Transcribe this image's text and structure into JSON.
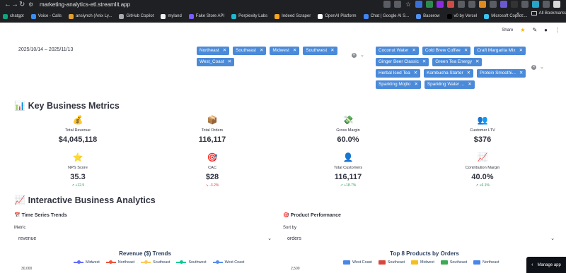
{
  "browser": {
    "url": "marketing-analytics-etl.streamlit.app",
    "bookmarks": [
      {
        "label": "chatgpt",
        "color": "#10a37f"
      },
      {
        "label": "Voice - Calls",
        "color": "#3c8df0"
      },
      {
        "label": "ansiynch (Anix Ly...",
        "color": "#e0a030"
      },
      {
        "label": "GitHub Copilot",
        "color": "#aaaaaa"
      },
      {
        "label": "myland",
        "color": "#f0f0f0"
      },
      {
        "label": "Fake Store API",
        "color": "#7a5cff"
      },
      {
        "label": "Perplexity Labs",
        "color": "#20b8cd"
      },
      {
        "label": "Indeed Scraper",
        "color": "#f5a623"
      },
      {
        "label": "OpenAI Platform",
        "color": "#ffffff"
      },
      {
        "label": "Chat | Google AI S...",
        "color": "#4285f4"
      },
      {
        "label": "Baserow",
        "color": "#5190ef"
      },
      {
        "label": "v0 by Vercel",
        "color": "#000000"
      },
      {
        "label": "Microsoft Copilot:...",
        "color": "#36c5f0"
      }
    ],
    "all_bookmarks": "All Bookmarks",
    "more": "»"
  },
  "header": {
    "share_label": "Share"
  },
  "filters": {
    "date_range": "2025/10/14 – 2025/11/13",
    "regions": [
      "Northeast",
      "Southeast",
      "Midwest",
      "Southwest",
      "West_Coast"
    ],
    "products": [
      "Coconut Water",
      "Cold Brew Coffee",
      "Craft Margarita Mix",
      "Ginger Beer Classic",
      "Green Tea Energy",
      "Herbal Iced Tea",
      "Kombucha Starter",
      "Protein Smoothi...",
      "Sparkling Mojito",
      "Sparkling Water ..."
    ],
    "chip_color": "#4a8ad9"
  },
  "key_metrics": {
    "heading_icon": "📊",
    "heading": "Key Business Metrics",
    "items": [
      {
        "icon": "💰",
        "label": "Total Revenue",
        "value": "$4,045,118",
        "delta": ""
      },
      {
        "icon": "📦",
        "label": "Total Orders",
        "value": "116,117",
        "delta": ""
      },
      {
        "icon": "💸",
        "label": "Gross Margin",
        "value": "60.0%",
        "delta": ""
      },
      {
        "icon": "👥",
        "label": "Customer LTV",
        "value": "$376",
        "delta": ""
      },
      {
        "icon": "⭐",
        "label": "NPS Score",
        "value": "35.3",
        "delta": "↗ +12.5"
      },
      {
        "icon": "🎯",
        "label": "CAC",
        "value": "$28",
        "delta": "↘ -3.2%"
      },
      {
        "icon": "👤",
        "label": "Total Customers",
        "value": "116,117",
        "delta": "↗ +18.7%"
      },
      {
        "icon": "📈",
        "label": "Contribution Margin",
        "value": "40.0%",
        "delta": "↗ +6.1%"
      }
    ]
  },
  "analytics": {
    "heading_icon": "📈",
    "heading": "Interactive Business Analytics",
    "time_series": {
      "title_icon": "📅",
      "title": "Time Series Trends",
      "metric_label": "Metric",
      "metric_value": "revenue",
      "chart_title": "Revenue ($) Trends",
      "y_top_tick": "30,000",
      "legend": [
        {
          "name": "Midwest",
          "color": "#636efa"
        },
        {
          "name": "Northeast",
          "color": "#ef553b"
        },
        {
          "name": "Southeast",
          "color": "#fecb52"
        },
        {
          "name": "Southwest",
          "color": "#00cc96"
        },
        {
          "name": "West Coast",
          "color": "#5a8ef0"
        }
      ]
    },
    "product_performance": {
      "title_icon": "🎯",
      "title": "Product Performance",
      "sort_label": "Sort by",
      "sort_value": "orders",
      "chart_title": "Top 8 Products by Orders",
      "y_top_tick": "2,500",
      "legend": [
        {
          "name": "West Coast",
          "color": "#4a86e8"
        },
        {
          "name": "Southeast",
          "color": "#d9453c"
        },
        {
          "name": "Midwest",
          "color": "#f4c020"
        },
        {
          "name": "Southeast",
          "color": "#3da954"
        },
        {
          "name": "Northeast",
          "color": "#4a86e8"
        }
      ]
    }
  },
  "manage_app": "Manage app"
}
